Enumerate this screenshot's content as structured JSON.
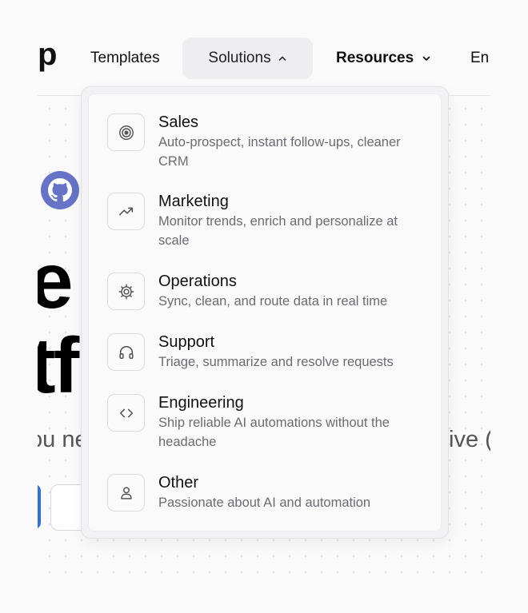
{
  "nav": {
    "logo_fragment": "p",
    "templates": "Templates",
    "solutions": "Solutions",
    "resources": "Resources",
    "enterprise_fragment": "En"
  },
  "hero": {
    "line1": "e A         at",
    "line2": "tf                f",
    "sub_left": "ou ne",
    "sub_right": "tive ("
  },
  "dropdown": {
    "items": [
      {
        "title": "Sales",
        "desc": "Auto-prospect, instant follow-ups, cleaner CRM",
        "icon": "target-icon"
      },
      {
        "title": "Marketing",
        "desc": "Monitor trends, enrich and personalize at scale",
        "icon": "trending-up-icon"
      },
      {
        "title": "Operations",
        "desc": "Sync, clean, and route data in real time",
        "icon": "gear-icon"
      },
      {
        "title": "Support",
        "desc": "Triage, summarize and resolve requests",
        "icon": "headphones-icon"
      },
      {
        "title": "Engineering",
        "desc": "Ship reliable AI automations without the headache",
        "icon": "code-icon"
      },
      {
        "title": "Other",
        "desc": "Passionate about AI and automation",
        "icon": "user-icon"
      }
    ]
  },
  "colors": {
    "background": "#fafafa",
    "active_nav_bg": "#eeeef1",
    "github_avatar": "#6673c6",
    "primary_button": "#2f6fe0",
    "muted_text": "#6b6b73"
  }
}
